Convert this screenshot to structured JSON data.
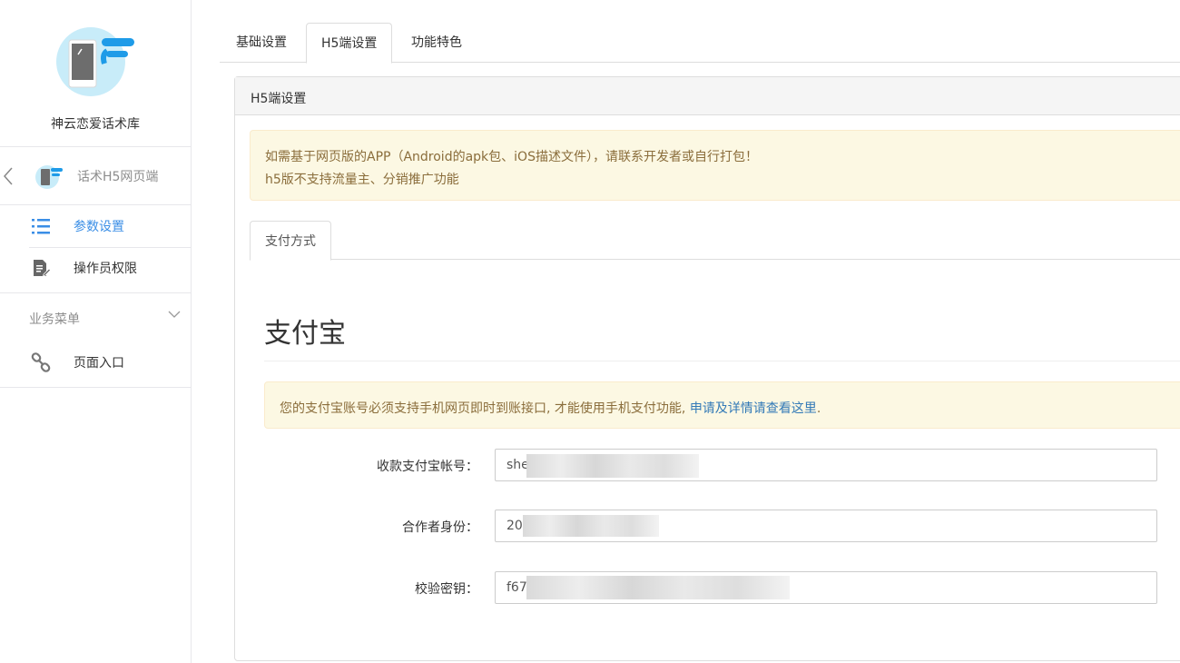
{
  "sidebar": {
    "app_name": "神云恋爱话术库",
    "sub_app_name": "话术H5网页端",
    "items": [
      {
        "label": "参数设置",
        "active": true
      },
      {
        "label": "操作员权限"
      }
    ],
    "section_title": "业务菜单",
    "section_items": [
      {
        "label": "页面入口"
      }
    ]
  },
  "tabs": [
    {
      "label": "基础设置"
    },
    {
      "label": "H5端设置",
      "active": true
    },
    {
      "label": "功能特色"
    }
  ],
  "panel": {
    "title": "H5端设置",
    "notice_line1": "如需基于网页版的APP（Android的apk包、iOS描述文件），请联系开发者或自行打包！",
    "notice_line2": "h5版不支持流量主、分销推广功能",
    "inner_tab": "支付方式",
    "section_title": "支付宝",
    "alipay_notice": "您的支付宝账号必须支持手机网页即时到账接口, 才能使用手机支付功能,",
    "alipay_link": "申请及详情请查看这里",
    "alipay_notice_end": ".",
    "fields": [
      {
        "label": "收款支付宝帐号：",
        "value": "she"
      },
      {
        "label": "合作者身份：",
        "value": "20"
      },
      {
        "label": "校验密钥：",
        "value": "f67"
      }
    ]
  },
  "colors": {
    "accent": "#3a8ee6",
    "logo_bg": "#c8ecf9",
    "warning_bg": "#fcf8e3",
    "warning_text": "#8a6d3b",
    "link": "#337ab7"
  }
}
